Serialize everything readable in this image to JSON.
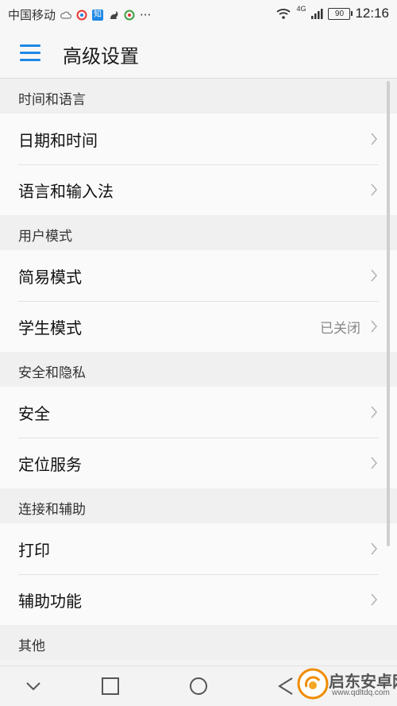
{
  "status_bar": {
    "carrier": "中国移动",
    "zhi_label": "知",
    "more": "···",
    "network": "4G",
    "battery": "90",
    "time": "12:16"
  },
  "header": {
    "title": "高级设置"
  },
  "sections": [
    {
      "title": "时间和语言",
      "items": [
        {
          "label": "日期和时间"
        },
        {
          "label": "语言和输入法"
        }
      ]
    },
    {
      "title": "用户模式",
      "items": [
        {
          "label": "简易模式"
        },
        {
          "label": "学生模式",
          "value": "已关闭"
        }
      ]
    },
    {
      "title": "安全和隐私",
      "items": [
        {
          "label": "安全"
        },
        {
          "label": "定位服务"
        }
      ]
    },
    {
      "title": "连接和辅助",
      "items": [
        {
          "label": "打印"
        },
        {
          "label": "辅助功能"
        }
      ]
    },
    {
      "title": "其他",
      "items": []
    }
  ],
  "nav_bar": {
    "icons": [
      "chevron-down-icon",
      "recent-apps-icon",
      "home-icon",
      "back-icon"
    ]
  },
  "watermark": {
    "title": "启东安卓网",
    "url": "www.qdltdq.com"
  },
  "colors": {
    "accent": "#1e88e5",
    "background": "#f3f3f3",
    "row_background": "#fafafa"
  }
}
